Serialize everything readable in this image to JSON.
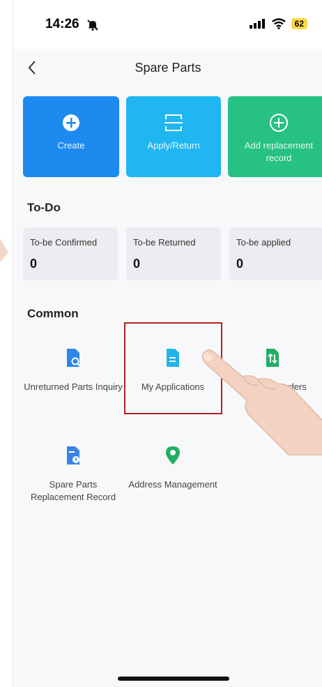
{
  "status_bar": {
    "time": "14:26",
    "battery": "62"
  },
  "header": {
    "title": "Spare Parts"
  },
  "actions": [
    {
      "label": "Create",
      "color": "#1d8af0"
    },
    {
      "label": "Apply/Return",
      "color": "#1fb6f2"
    },
    {
      "label": "Add replacement record",
      "color": "#26c183"
    }
  ],
  "todo": {
    "title": "To-Do",
    "items": [
      {
        "label": "To-be Confirmed",
        "value": "0"
      },
      {
        "label": "To-be Returned",
        "value": "0"
      },
      {
        "label": "To-be applied",
        "value": "0"
      }
    ]
  },
  "common": {
    "title": "Common",
    "items": [
      {
        "label": "Unreturned Parts Inquiry",
        "icon": "document-search-icon"
      },
      {
        "label": "My Applications",
        "icon": "document-icon"
      },
      {
        "label": "Orders",
        "icon": "transfer-document-icon"
      },
      {
        "label": "Spare Parts Replacement Record",
        "icon": "document-clock-icon"
      },
      {
        "label": "Address Management",
        "icon": "location-pin-icon"
      }
    ]
  }
}
